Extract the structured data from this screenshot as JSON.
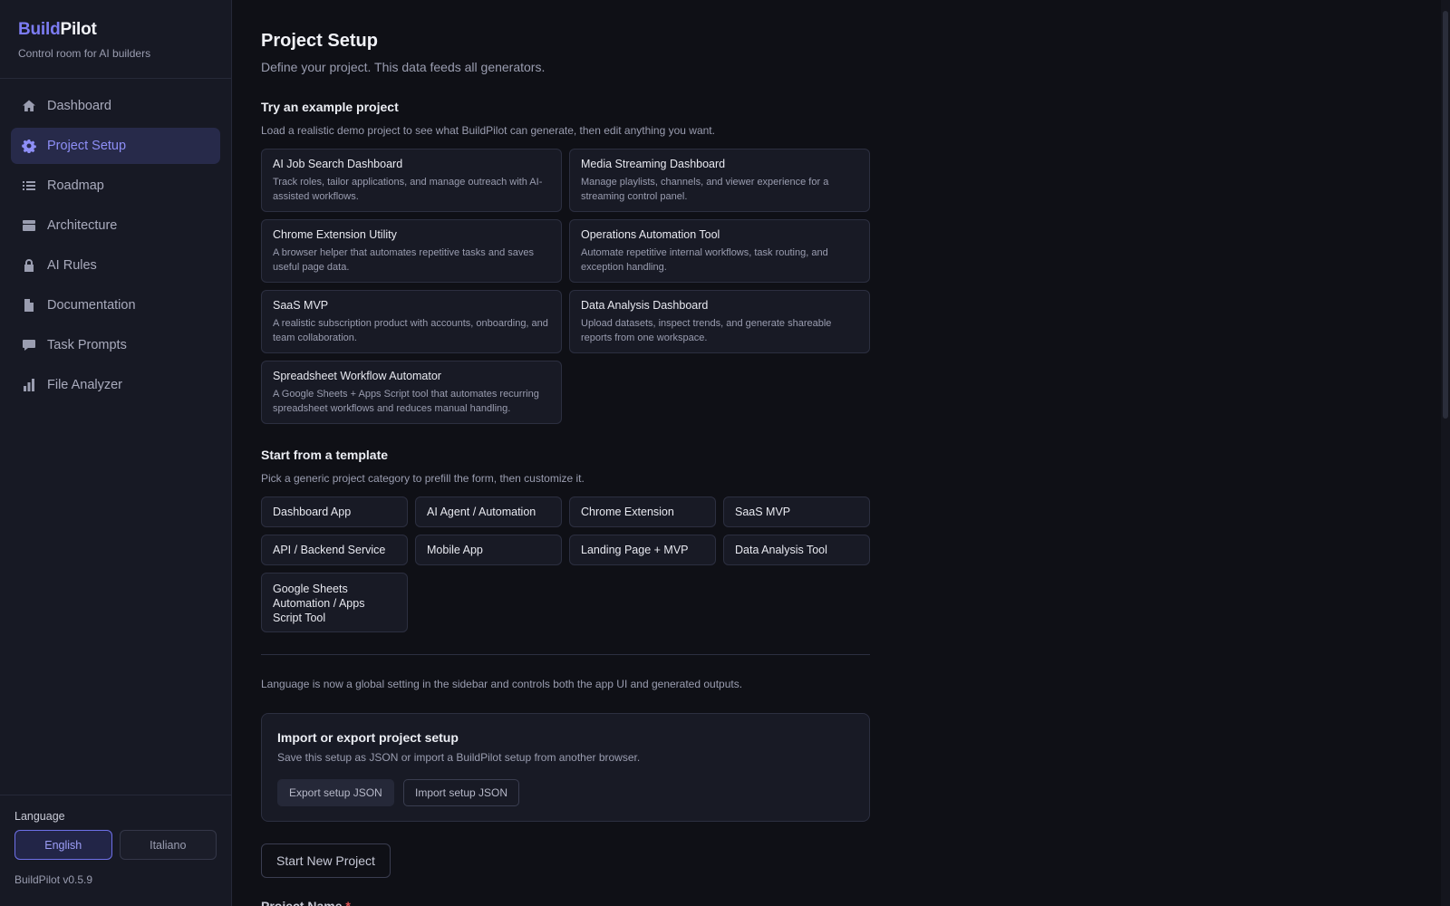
{
  "sidebar": {
    "brand_part1": "Build",
    "brand_part2": "Pilot",
    "tagline": "Control room for AI builders",
    "nav": [
      {
        "label": "Dashboard",
        "icon": "home-icon"
      },
      {
        "label": "Project Setup",
        "icon": "gear-icon",
        "active": true
      },
      {
        "label": "Roadmap",
        "icon": "list-icon"
      },
      {
        "label": "Architecture",
        "icon": "box-icon"
      },
      {
        "label": "AI Rules",
        "icon": "lock-icon"
      },
      {
        "label": "Documentation",
        "icon": "document-icon"
      },
      {
        "label": "Task Prompts",
        "icon": "chat-bubble-icon"
      },
      {
        "label": "File Analyzer",
        "icon": "bar-chart-icon"
      }
    ],
    "language_title": "Language",
    "languages": [
      "English",
      "Italiano"
    ],
    "selected_language": "English",
    "version": "BuildPilot v0.5.9"
  },
  "main": {
    "title": "Project Setup",
    "subtitle": "Define your project. This data feeds all generators.",
    "examples": {
      "title": "Try an example project",
      "subtitle": "Load a realistic demo project to see what BuildPilot can generate, then edit anything you want.",
      "items": [
        {
          "title": "AI Job Search Dashboard",
          "desc": "Track roles, tailor applications, and manage outreach with AI-assisted workflows."
        },
        {
          "title": "Media Streaming Dashboard",
          "desc": "Manage playlists, channels, and viewer experience for a streaming control panel."
        },
        {
          "title": "Chrome Extension Utility",
          "desc": "A browser helper that automates repetitive tasks and saves useful page data."
        },
        {
          "title": "Operations Automation Tool",
          "desc": "Automate repetitive internal workflows, task routing, and exception handling."
        },
        {
          "title": "SaaS MVP",
          "desc": "A realistic subscription product with accounts, onboarding, and team collaboration."
        },
        {
          "title": "Data Analysis Dashboard",
          "desc": "Upload datasets, inspect trends, and generate shareable reports from one workspace."
        },
        {
          "title": "Spreadsheet Workflow Automator",
          "desc": "A Google Sheets + Apps Script tool that automates recurring spreadsheet workflows and reduces manual handling."
        }
      ]
    },
    "templates": {
      "title": "Start from a template",
      "subtitle": "Pick a generic project category to prefill the form, then customize it.",
      "items": [
        "Dashboard App",
        "AI Agent / Automation",
        "Chrome Extension",
        "SaaS MVP",
        "API / Backend Service",
        "Mobile App",
        "Landing Page + MVP",
        "Data Analysis Tool",
        "Google Sheets Automation / Apps Script Tool"
      ]
    },
    "language_note": "Language is now a global setting in the sidebar and controls both the app UI and generated outputs.",
    "import_export": {
      "title": "Import or export project setup",
      "subtitle": "Save this setup as JSON or import a BuildPilot setup from another browser.",
      "export_label": "Export setup JSON",
      "import_label": "Import setup JSON"
    },
    "start_new_label": "Start New Project",
    "project_name_label": "Project Name",
    "required_marker": "*"
  },
  "colors": {
    "accent": "#7c7cf3",
    "background": "#0f1016",
    "sidebar": "#171924",
    "card": "#181a25",
    "required": "#e05555"
  }
}
